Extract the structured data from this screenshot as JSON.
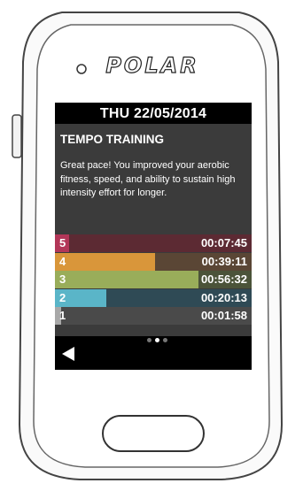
{
  "brand": "POLAR",
  "screen": {
    "date": "THU 22/05/2014",
    "title": "TEMPO TRAINING",
    "message": "Great pace! You improved your aerobic fitness, speed, and ability to sustain high intensity effort for longer."
  },
  "zones": [
    {
      "label": "5",
      "time": "00:07:45",
      "fraction": 0.07,
      "fill_color": "#b23658",
      "bg_color": "#5c2a33"
    },
    {
      "label": "4",
      "time": "00:39:11",
      "fraction": 0.51,
      "fill_color": "#d9963a",
      "bg_color": "#5a4635"
    },
    {
      "label": "3",
      "time": "00:56:32",
      "fraction": 0.73,
      "fill_color": "#99ad5a",
      "bg_color": "#4b5339"
    },
    {
      "label": "2",
      "time": "00:20:13",
      "fraction": 0.26,
      "fill_color": "#5ab5c8",
      "bg_color": "#2f4a55"
    },
    {
      "label": "1",
      "time": "00:01:58",
      "fraction": 0.03,
      "fill_color": "#a8a8a8",
      "bg_color": "#4a4a4a"
    }
  ],
  "pagination": {
    "pages": 3,
    "current": 1
  },
  "nav": {
    "back_icon": "back-arrow-icon"
  }
}
